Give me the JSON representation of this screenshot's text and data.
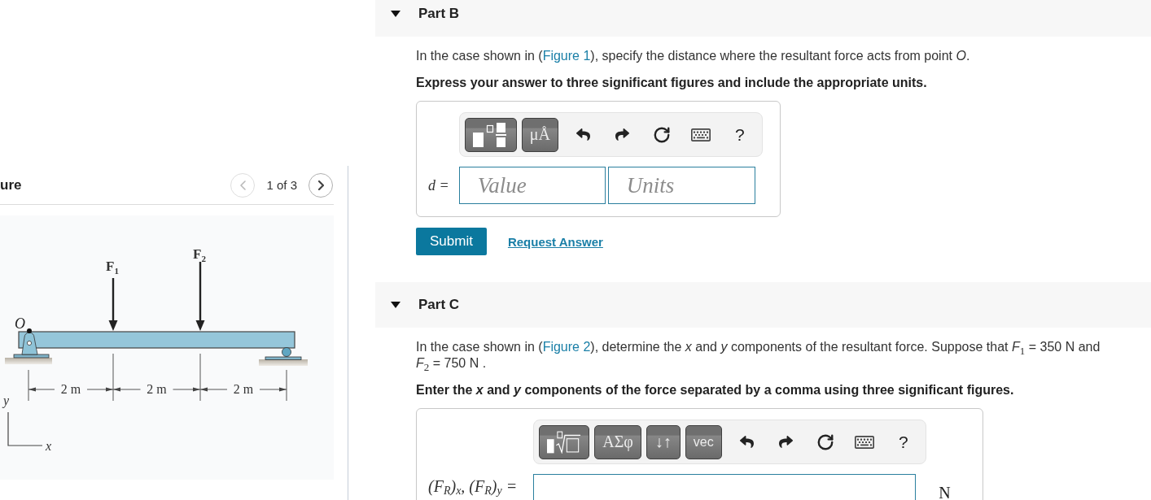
{
  "figure_panel": {
    "title": "ure",
    "pager": {
      "previous": {
        "disabled": true
      },
      "position": "1 of 3",
      "next": {
        "disabled": false
      }
    },
    "figure": {
      "point_label": "O",
      "forces": [
        {
          "symbol": "F",
          "index": "1"
        },
        {
          "symbol": "F",
          "index": "2"
        }
      ],
      "spans": [
        "2 m",
        "2 m",
        "2 m"
      ],
      "axes": {
        "vertical": "y",
        "horizontal": "x"
      }
    }
  },
  "parts": [
    {
      "title": "Part B",
      "expanded": true,
      "question": {
        "before": "In the case shown in (",
        "link": "Figure 1",
        "after": "), specify the distance where the resultant force acts from point *O*."
      },
      "instruction": "Express your answer to three significant figures and include the appropriate units.",
      "answer": {
        "kind": "value_units",
        "toolbar": [
          {
            "kind": "template"
          },
          {
            "kind": "symbols",
            "label": "μÅ"
          },
          {
            "kind": "undo"
          },
          {
            "kind": "redo"
          },
          {
            "kind": "reset"
          },
          {
            "kind": "keyboard"
          },
          {
            "kind": "help",
            "label": "?"
          }
        ],
        "label": "d =",
        "fields": [
          {
            "placeholder": "Value"
          },
          {
            "placeholder": "Units"
          }
        ]
      },
      "submit": "Submit",
      "request_answer": "Request Answer"
    },
    {
      "title": "Part C",
      "expanded": true,
      "question": {
        "before": "In the case shown in (",
        "link": "Figure 2",
        "after": "), determine the *x* and *y* components of the resultant force. Suppose that *F*$_{1}$ = 350 N and *F*$_{2}$ = 750 N ."
      },
      "instruction": "Enter the *x* and *y* components of the force separated by a comma using three significant figures.",
      "answer": {
        "kind": "with_unit",
        "toolbar": [
          {
            "kind": "radical"
          },
          {
            "kind": "symbols",
            "label": "ΑΣφ"
          },
          {
            "kind": "symbols",
            "label": "↓↑"
          },
          {
            "kind": "vector",
            "label": "vec"
          },
          {
            "kind": "undo"
          },
          {
            "kind": "redo"
          },
          {
            "kind": "reset"
          },
          {
            "kind": "keyboard"
          },
          {
            "kind": "help",
            "label": "?"
          }
        ],
        "label": "(F$_{R}$)$_{x}$, (F$_{R}$)$_{y}$ =",
        "unit": "N"
      }
    }
  ]
}
